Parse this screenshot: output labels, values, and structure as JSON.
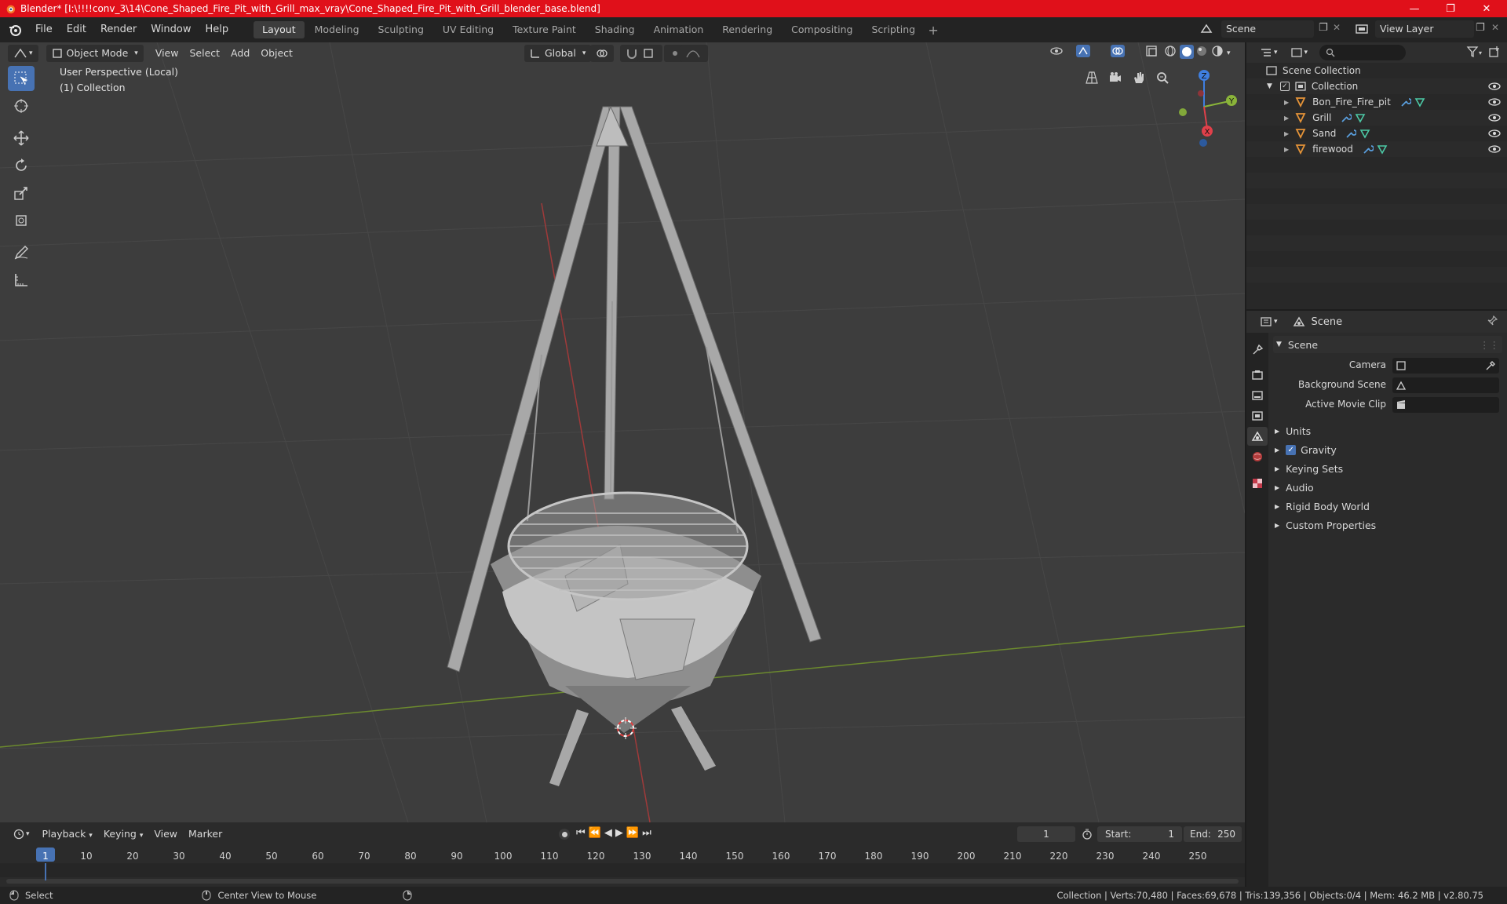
{
  "window": {
    "title": "Blender* [I:\\!!!!conv_3\\14\\Cone_Shaped_Fire_Pit_with_Grill_max_vray\\Cone_Shaped_Fire_Pit_with_Grill_blender_base.blend]",
    "minimize": "—",
    "maximize": "❐",
    "close": "✕"
  },
  "menu": [
    "File",
    "Edit",
    "Render",
    "Window",
    "Help"
  ],
  "workspaces": [
    {
      "label": "Layout",
      "active": true
    },
    {
      "label": "Modeling"
    },
    {
      "label": "Sculpting"
    },
    {
      "label": "UV Editing"
    },
    {
      "label": "Texture Paint"
    },
    {
      "label": "Shading"
    },
    {
      "label": "Animation"
    },
    {
      "label": "Rendering"
    },
    {
      "label": "Compositing"
    },
    {
      "label": "Scripting"
    }
  ],
  "scene_selector": {
    "value": "Scene"
  },
  "view_layer_selector": {
    "value": "View Layer"
  },
  "viewport": {
    "mode": "Object Mode",
    "menus": [
      "View",
      "Select",
      "Add",
      "Object"
    ],
    "transform_orientation": "Global",
    "overlay_line1": "User Perspective (Local)",
    "overlay_line2": "(1) Collection",
    "gizmo": {
      "x": "X",
      "y": "Y",
      "z": "Z"
    }
  },
  "outliner": {
    "root": "Scene Collection",
    "collection": "Collection",
    "objects": [
      "Bon_Fire_Fire_pit",
      "Grill",
      "Sand",
      "firewood"
    ]
  },
  "properties": {
    "header": "Scene",
    "panel": "Scene",
    "fields": [
      {
        "label": "Camera"
      },
      {
        "label": "Background Scene"
      },
      {
        "label": "Active Movie Clip"
      }
    ],
    "sections": [
      "Units",
      "Gravity",
      "Keying Sets",
      "Audio",
      "Rigid Body World",
      "Custom Properties"
    ]
  },
  "timeline": {
    "menus": [
      "Playback",
      "Keying",
      "View",
      "Marker"
    ],
    "current_frame": "1",
    "start_label": "Start:",
    "start": "1",
    "end_label": "End:",
    "end": "250",
    "ruler": [
      "1",
      "10",
      "20",
      "30",
      "40",
      "50",
      "60",
      "70",
      "80",
      "90",
      "100",
      "110",
      "120",
      "130",
      "140",
      "150",
      "160",
      "170",
      "180",
      "190",
      "200",
      "210",
      "220",
      "230",
      "240",
      "250"
    ]
  },
  "status": {
    "select": "Select",
    "center_view": "Center View to Mouse",
    "stats": "Collection | Verts:70,480 | Faces:69,678 | Tris:139,356 | Objects:0/4 | Mem: 46.2 MB | v2.80.75"
  },
  "colors": {
    "titlebar": "#e0101a",
    "accent": "#4772b3",
    "axis_x": "#e0404a",
    "axis_y": "#8ab43a",
    "axis_z": "#3f7fe0",
    "object_orange": "#e69438",
    "modifier_blue": "#5aa0e0",
    "mesh_green": "#4cc9a6"
  }
}
